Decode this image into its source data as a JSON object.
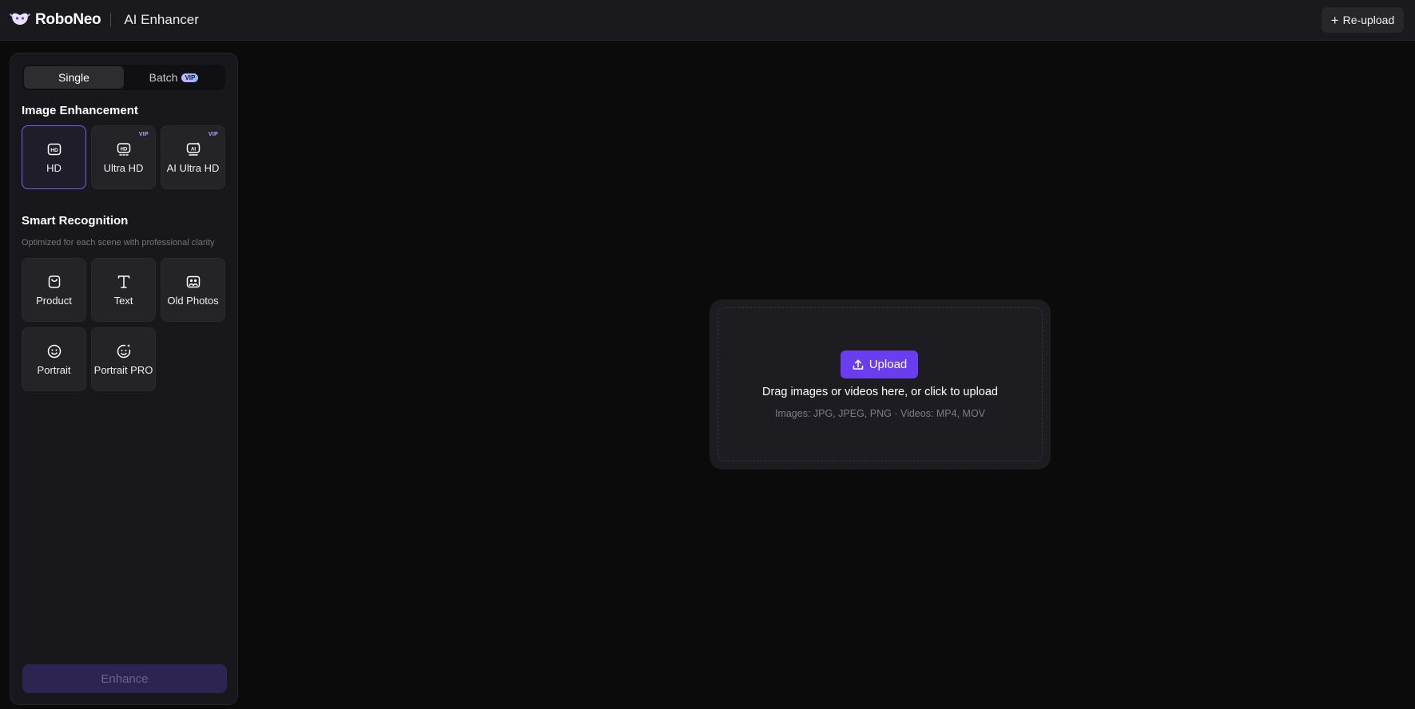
{
  "header": {
    "brand": "RoboNeo",
    "product": "AI Enhancer",
    "reupload_label": "Re-upload"
  },
  "tabs": [
    {
      "label": "Single",
      "active": true
    },
    {
      "label": "Batch",
      "badge": "VIP",
      "active": false
    }
  ],
  "image_enhancement": {
    "title": "Image Enhancement",
    "options": [
      {
        "label": "HD",
        "icon": "hd-icon",
        "selected": true
      },
      {
        "label": "Ultra HD",
        "icon": "ultra-hd-icon",
        "badge": "VIP"
      },
      {
        "label": "AI Ultra HD",
        "icon": "ai-ultra-hd-icon",
        "badge": "VIP"
      }
    ]
  },
  "smart_recognition": {
    "title": "Smart Recognition",
    "subtitle": "Optimized for each scene with professional clarity",
    "options": [
      {
        "label": "Product",
        "icon": "bag-icon"
      },
      {
        "label": "Text",
        "icon": "text-icon"
      },
      {
        "label": "Old Photos",
        "icon": "photo-icon"
      },
      {
        "label": "Portrait",
        "icon": "smile-icon"
      },
      {
        "label": "Portrait PRO",
        "icon": "smile-pro-icon"
      }
    ]
  },
  "enhance_label": "Enhance",
  "dropzone": {
    "upload_label": "Upload",
    "title": "Drag images or videos here, or click to upload",
    "formats": "Images: JPG, JPEG, PNG  ·  Videos: MP4, MOV"
  },
  "colors": {
    "accent": "#6a3df0",
    "background": "#0b0b0c",
    "panel": "#18181c"
  }
}
